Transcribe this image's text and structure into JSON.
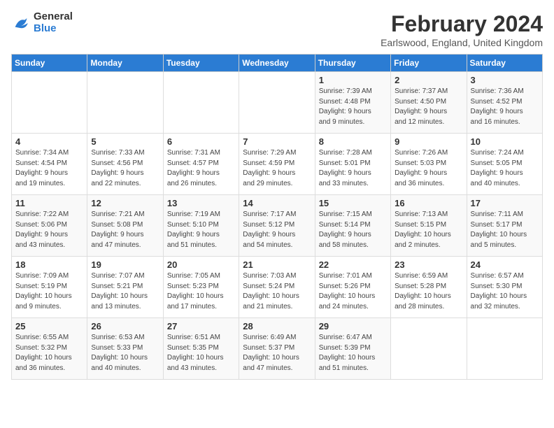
{
  "header": {
    "logo_line1": "General",
    "logo_line2": "Blue",
    "month": "February 2024",
    "location": "Earlswood, England, United Kingdom"
  },
  "days_of_week": [
    "Sunday",
    "Monday",
    "Tuesday",
    "Wednesday",
    "Thursday",
    "Friday",
    "Saturday"
  ],
  "weeks": [
    [
      {
        "day": "",
        "info": ""
      },
      {
        "day": "",
        "info": ""
      },
      {
        "day": "",
        "info": ""
      },
      {
        "day": "",
        "info": ""
      },
      {
        "day": "1",
        "info": "Sunrise: 7:39 AM\nSunset: 4:48 PM\nDaylight: 9 hours\nand 9 minutes."
      },
      {
        "day": "2",
        "info": "Sunrise: 7:37 AM\nSunset: 4:50 PM\nDaylight: 9 hours\nand 12 minutes."
      },
      {
        "day": "3",
        "info": "Sunrise: 7:36 AM\nSunset: 4:52 PM\nDaylight: 9 hours\nand 16 minutes."
      }
    ],
    [
      {
        "day": "4",
        "info": "Sunrise: 7:34 AM\nSunset: 4:54 PM\nDaylight: 9 hours\nand 19 minutes."
      },
      {
        "day": "5",
        "info": "Sunrise: 7:33 AM\nSunset: 4:56 PM\nDaylight: 9 hours\nand 22 minutes."
      },
      {
        "day": "6",
        "info": "Sunrise: 7:31 AM\nSunset: 4:57 PM\nDaylight: 9 hours\nand 26 minutes."
      },
      {
        "day": "7",
        "info": "Sunrise: 7:29 AM\nSunset: 4:59 PM\nDaylight: 9 hours\nand 29 minutes."
      },
      {
        "day": "8",
        "info": "Sunrise: 7:28 AM\nSunset: 5:01 PM\nDaylight: 9 hours\nand 33 minutes."
      },
      {
        "day": "9",
        "info": "Sunrise: 7:26 AM\nSunset: 5:03 PM\nDaylight: 9 hours\nand 36 minutes."
      },
      {
        "day": "10",
        "info": "Sunrise: 7:24 AM\nSunset: 5:05 PM\nDaylight: 9 hours\nand 40 minutes."
      }
    ],
    [
      {
        "day": "11",
        "info": "Sunrise: 7:22 AM\nSunset: 5:06 PM\nDaylight: 9 hours\nand 43 minutes."
      },
      {
        "day": "12",
        "info": "Sunrise: 7:21 AM\nSunset: 5:08 PM\nDaylight: 9 hours\nand 47 minutes."
      },
      {
        "day": "13",
        "info": "Sunrise: 7:19 AM\nSunset: 5:10 PM\nDaylight: 9 hours\nand 51 minutes."
      },
      {
        "day": "14",
        "info": "Sunrise: 7:17 AM\nSunset: 5:12 PM\nDaylight: 9 hours\nand 54 minutes."
      },
      {
        "day": "15",
        "info": "Sunrise: 7:15 AM\nSunset: 5:14 PM\nDaylight: 9 hours\nand 58 minutes."
      },
      {
        "day": "16",
        "info": "Sunrise: 7:13 AM\nSunset: 5:15 PM\nDaylight: 10 hours\nand 2 minutes."
      },
      {
        "day": "17",
        "info": "Sunrise: 7:11 AM\nSunset: 5:17 PM\nDaylight: 10 hours\nand 5 minutes."
      }
    ],
    [
      {
        "day": "18",
        "info": "Sunrise: 7:09 AM\nSunset: 5:19 PM\nDaylight: 10 hours\nand 9 minutes."
      },
      {
        "day": "19",
        "info": "Sunrise: 7:07 AM\nSunset: 5:21 PM\nDaylight: 10 hours\nand 13 minutes."
      },
      {
        "day": "20",
        "info": "Sunrise: 7:05 AM\nSunset: 5:23 PM\nDaylight: 10 hours\nand 17 minutes."
      },
      {
        "day": "21",
        "info": "Sunrise: 7:03 AM\nSunset: 5:24 PM\nDaylight: 10 hours\nand 21 minutes."
      },
      {
        "day": "22",
        "info": "Sunrise: 7:01 AM\nSunset: 5:26 PM\nDaylight: 10 hours\nand 24 minutes."
      },
      {
        "day": "23",
        "info": "Sunrise: 6:59 AM\nSunset: 5:28 PM\nDaylight: 10 hours\nand 28 minutes."
      },
      {
        "day": "24",
        "info": "Sunrise: 6:57 AM\nSunset: 5:30 PM\nDaylight: 10 hours\nand 32 minutes."
      }
    ],
    [
      {
        "day": "25",
        "info": "Sunrise: 6:55 AM\nSunset: 5:32 PM\nDaylight: 10 hours\nand 36 minutes."
      },
      {
        "day": "26",
        "info": "Sunrise: 6:53 AM\nSunset: 5:33 PM\nDaylight: 10 hours\nand 40 minutes."
      },
      {
        "day": "27",
        "info": "Sunrise: 6:51 AM\nSunset: 5:35 PM\nDaylight: 10 hours\nand 43 minutes."
      },
      {
        "day": "28",
        "info": "Sunrise: 6:49 AM\nSunset: 5:37 PM\nDaylight: 10 hours\nand 47 minutes."
      },
      {
        "day": "29",
        "info": "Sunrise: 6:47 AM\nSunset: 5:39 PM\nDaylight: 10 hours\nand 51 minutes."
      },
      {
        "day": "",
        "info": ""
      },
      {
        "day": "",
        "info": ""
      }
    ]
  ]
}
